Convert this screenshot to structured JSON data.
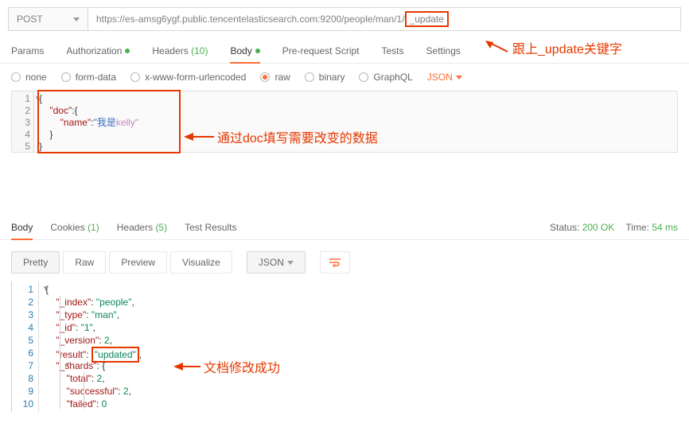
{
  "request": {
    "method": "POST",
    "url_prefix": "https://es-amsg6ygf.public.tencentelasticsearch.com:9200/people/man/1/",
    "url_highlight": "_update"
  },
  "annotations": {
    "url_note": "跟上_update关键字",
    "body_note": "通过doc填写需要改变的数据",
    "result_note": "文档修改成功"
  },
  "req_tabs": {
    "params": "Params",
    "auth": "Authorization",
    "headers": "Headers",
    "headers_count": "(10)",
    "body": "Body",
    "prerequest": "Pre-request Script",
    "tests": "Tests",
    "settings": "Settings"
  },
  "body_types": {
    "none": "none",
    "formdata": "form-data",
    "urlencoded": "x-www-form-urlencoded",
    "raw": "raw",
    "binary": "binary",
    "graphql": "GraphQL",
    "json": "JSON"
  },
  "req_body": {
    "doc_key": "\"doc\"",
    "name_key": "\"name\"",
    "name_val_cn": "\"我是",
    "name_val_en": "kelly\""
  },
  "resp_tabs": {
    "body": "Body",
    "cookies": "Cookies",
    "cookies_count": "(1)",
    "headers": "Headers",
    "headers_count": "(5)",
    "tests": "Test Results"
  },
  "resp_status": {
    "status_label": "Status:",
    "status_val": "200 OK",
    "time_label": "Time:",
    "time_val": "54 ms"
  },
  "resp_controls": {
    "pretty": "Pretty",
    "raw": "Raw",
    "preview": "Preview",
    "visualize": "Visualize",
    "json": "JSON"
  },
  "resp_body": {
    "index_k": "\"_index\"",
    "index_v": "\"people\"",
    "type_k": "\"_type\"",
    "type_v": "\"man\"",
    "id_k": "\"_id\"",
    "id_v": "\"1\"",
    "version_k": "\"_version\"",
    "version_v": "2",
    "result_k": "\"result\"",
    "result_v": "\"updated\"",
    "shards_k": "\"_shards\"",
    "total_k": "\"total\"",
    "total_v": "2",
    "successful_k": "\"successful\"",
    "successful_v": "2",
    "failed_k": "\"failed\"",
    "failed_v": "0"
  }
}
